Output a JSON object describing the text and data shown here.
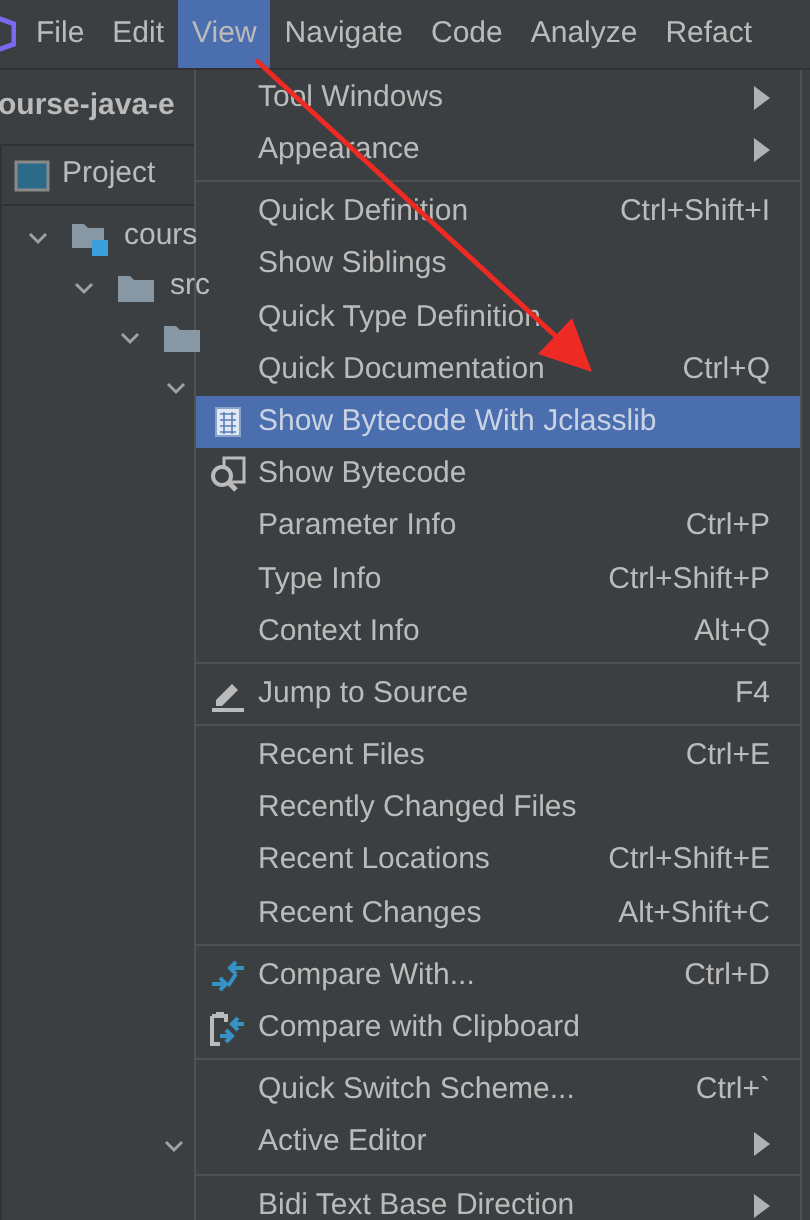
{
  "menu_bar": [
    {
      "label": "File",
      "selected": false
    },
    {
      "label": "Edit",
      "selected": false
    },
    {
      "label": "View",
      "selected": true
    },
    {
      "label": "Navigate",
      "selected": false
    },
    {
      "label": "Code",
      "selected": false
    },
    {
      "label": "Analyze",
      "selected": false
    },
    {
      "label": "Refact",
      "selected": false
    }
  ],
  "project_title": "ourse-java-e",
  "tool_tab": "Project",
  "tree": [
    {
      "label": "cours",
      "kind": "module",
      "expanded": true,
      "children": [
        {
          "label": "src",
          "kind": "folder",
          "expanded": true,
          "children": [
            {
              "kind": "folder",
              "expanded": true,
              "children": [
                {
                  "expanded": true
                }
              ]
            }
          ]
        }
      ]
    }
  ],
  "lower_chevron": {
    "expanded": true
  },
  "view_menu": [
    [
      {
        "label": "Tool Windows",
        "kind": "plain",
        "submenu": true,
        "selected": false
      },
      {
        "label": "Appearance",
        "kind": "plain",
        "submenu": true,
        "selected": false
      }
    ],
    [
      {
        "label": "Quick Definition",
        "kind": "plain",
        "shortcut": "Ctrl+Shift+I",
        "selected": false
      },
      {
        "label": "Show Siblings",
        "kind": "plain",
        "selected": false
      },
      {
        "label": "Quick Type Definition",
        "kind": "plain",
        "selected": false
      },
      {
        "label": "Quick Documentation",
        "kind": "plain",
        "shortcut": "Ctrl+Q",
        "selected": false
      },
      {
        "label": "Show Bytecode With Jclasslib",
        "kind": "grid",
        "selected": true
      },
      {
        "label": "Show Bytecode",
        "kind": "lens",
        "selected": false
      },
      {
        "label": "Parameter Info",
        "kind": "plain",
        "shortcut": "Ctrl+P",
        "selected": false
      },
      {
        "label": "Type Info",
        "kind": "plain",
        "shortcut": "Ctrl+Shift+P",
        "selected": false
      },
      {
        "label": "Context Info",
        "kind": "plain",
        "shortcut": "Alt+Q",
        "selected": false
      }
    ],
    [
      {
        "label": "Jump to Source",
        "kind": "pencil",
        "shortcut": "F4",
        "selected": false
      }
    ],
    [
      {
        "label": "Recent Files",
        "kind": "plain",
        "shortcut": "Ctrl+E",
        "selected": false
      },
      {
        "label": "Recently Changed Files",
        "kind": "plain",
        "selected": false
      },
      {
        "label": "Recent Locations",
        "kind": "plain",
        "shortcut": "Ctrl+Shift+E",
        "selected": false
      },
      {
        "label": "Recent Changes",
        "kind": "plain",
        "shortcut": "Alt+Shift+C",
        "selected": false
      }
    ],
    [
      {
        "label": "Compare With...",
        "kind": "compare",
        "shortcut": "Ctrl+D",
        "selected": false
      },
      {
        "label": "Compare with Clipboard",
        "kind": "clipboard",
        "selected": false
      }
    ],
    [
      {
        "label": "Quick Switch Scheme...",
        "kind": "plain",
        "shortcut": "Ctrl+`",
        "selected": false
      },
      {
        "label": "Active Editor",
        "kind": "plain",
        "submenu": true,
        "selected": false
      }
    ],
    [
      {
        "label": "Bidi Text Base Direction",
        "kind": "plain",
        "submenu": true,
        "selected": false
      }
    ]
  ]
}
